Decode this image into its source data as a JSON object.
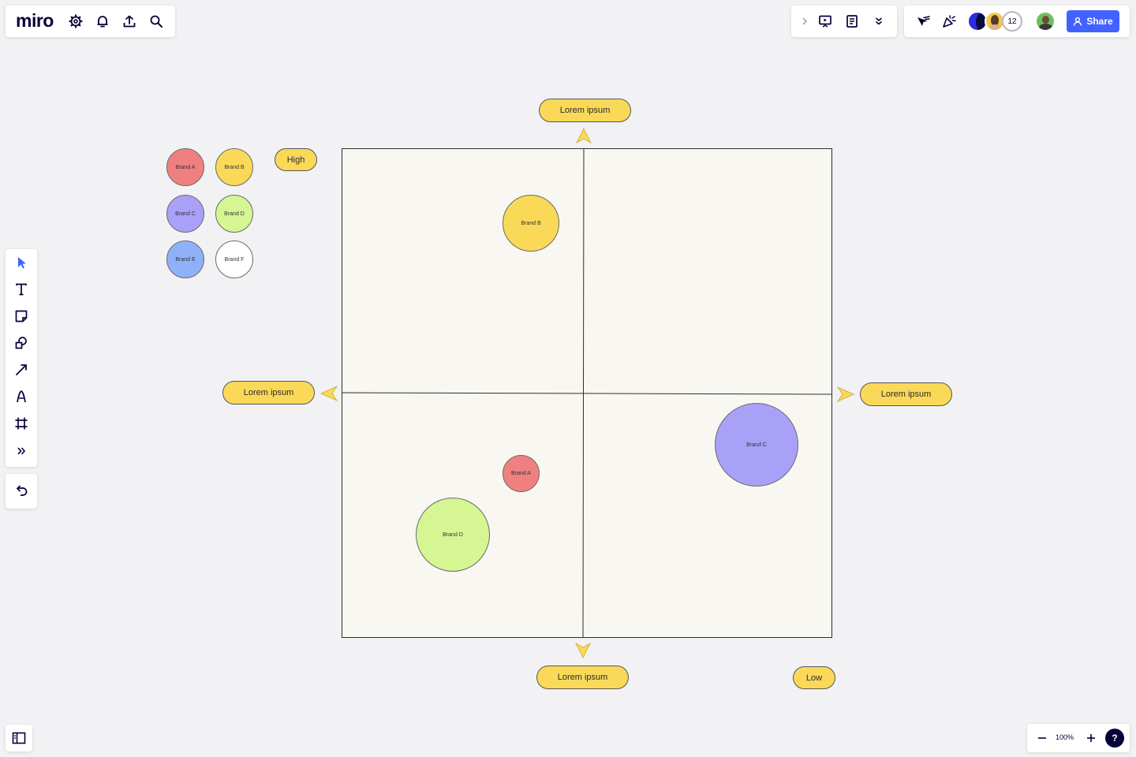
{
  "app": {
    "logo": "miro"
  },
  "topbar": {
    "left_icons": [
      "gear-icon",
      "bell-icon",
      "upload-icon",
      "search-icon"
    ],
    "center_icons": [
      "chevron-right-icon",
      "present-icon",
      "notes-icon",
      "double-chevron-down-icon"
    ],
    "right_icons": [
      "cursor-reaction-icon",
      "celebrate-icon"
    ],
    "collaborators_count": "12",
    "share_label": "Share"
  },
  "toolbar": {
    "tools": [
      "select-icon",
      "text-icon",
      "sticky-note-icon",
      "shapes-icon",
      "arrow-line-icon",
      "pen-icon",
      "frame-icon",
      "more-tools-icon"
    ],
    "undo_icon": "undo-icon"
  },
  "bottom": {
    "zoom": "100%",
    "help": "?"
  },
  "legend": [
    {
      "label": "Brand A",
      "color": "#f08080"
    },
    {
      "label": "Brand B",
      "color": "#fad958"
    },
    {
      "label": "Brand C",
      "color": "#a9a1f8"
    },
    {
      "label": "Brand D",
      "color": "#d5f692"
    },
    {
      "label": "Brand E",
      "color": "#8fb1fa"
    },
    {
      "label": "Brand F",
      "color": "#ffffff"
    }
  ],
  "labels": {
    "high": "High",
    "low": "Low",
    "top": "Lorem ipsum",
    "bottom": "Lorem ipsum",
    "left": "Lorem ipsum",
    "right": "Lorem ipsum"
  },
  "plotted": {
    "brand_b": "Brand B",
    "brand_a": "Brand A",
    "brand_d": "Brand D",
    "brand_c": "Brand C"
  },
  "colors": {
    "accent": "#4262ff",
    "pill": "#fad958",
    "board_bg": "#f9f7f1"
  }
}
